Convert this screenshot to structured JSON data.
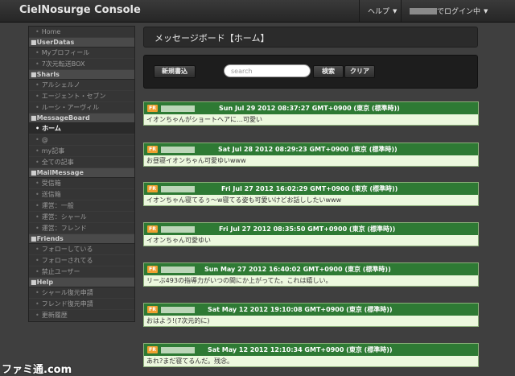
{
  "app": {
    "title": "CielNosurge Console"
  },
  "topnav": {
    "help": "ヘルプ",
    "login_suffix": "でログイン中"
  },
  "sidebar": {
    "home": "Home",
    "sections": [
      {
        "header": "UserDatas",
        "items": [
          {
            "label": "Myプロフィール"
          },
          {
            "label": "7次元転送BOX"
          }
        ]
      },
      {
        "header": "Sharls",
        "items": [
          {
            "label": "アルシェルノ"
          },
          {
            "label": "エージェント・セブン"
          },
          {
            "label": "ルーシ・アーヴィル"
          }
        ]
      },
      {
        "header": "MessageBoard",
        "items": [
          {
            "label": "ホーム",
            "active": true
          },
          {
            "label": "@"
          },
          {
            "label": "my記事"
          },
          {
            "label": "全ての記事"
          }
        ]
      },
      {
        "header": "MailMessage",
        "items": [
          {
            "label": "受信箱"
          },
          {
            "label": "送信箱"
          },
          {
            "label": "運営：一般"
          },
          {
            "label": "運営：シャール"
          },
          {
            "label": "運営：フレンド"
          }
        ]
      },
      {
        "header": "Friends",
        "items": [
          {
            "label": "フォローしている"
          },
          {
            "label": "フォローされてる"
          },
          {
            "label": "禁止ユーザー"
          }
        ]
      },
      {
        "header": "Help",
        "items": [
          {
            "label": "シャール復元申請"
          },
          {
            "label": "フレンド復元申請"
          },
          {
            "label": "更新履歴"
          }
        ]
      }
    ]
  },
  "main": {
    "title": "メッセージボード【ホーム】",
    "new_post_label": "新規書込",
    "search_placeholder": "search",
    "search_label": "検索",
    "clear_label": "クリア"
  },
  "messages": [
    {
      "badge": "FR",
      "date": "Sun Jul 29 2012 08:37:27 GMT+0900 (東京 (標準時))",
      "text": "イオンちゃんがショートヘアに…可愛い"
    },
    {
      "badge": "FR",
      "date": "Sat Jul 28 2012 08:29:23 GMT+0900 (東京 (標準時))",
      "text": "お昼寝イオンちゃん可愛ゆいwww"
    },
    {
      "badge": "FR",
      "date": "Fri Jul 27 2012 16:02:29 GMT+0900 (東京 (標準時))",
      "text": "イオンちゃん寝てるぅ〜w寝てる姿も可愛いけどお話ししたいwww"
    },
    {
      "badge": "FR",
      "date": "Fri Jul 27 2012 08:35:50 GMT+0900 (東京 (標準時))",
      "text": "イオンちゃん可愛ゆい"
    },
    {
      "badge": "FR",
      "date": "Sun May 27 2012 16:40:02 GMT+0900 (東京 (標準時))",
      "text": "リーぶ493の指導力がいつの間にか上がってた。これは嬉しい。"
    },
    {
      "badge": "FR",
      "date": "Sat May 12 2012 19:10:08 GMT+0900 (東京 (標準時))",
      "text": "おはよう!(7次元的に)"
    },
    {
      "badge": "FR",
      "date": "Sat May 12 2012 12:10:34 GMT+0900 (東京 (標準時))",
      "text": "あれ?まだ寝てるんだ。残念。"
    }
  ],
  "watermark": "ファミ通.com"
}
